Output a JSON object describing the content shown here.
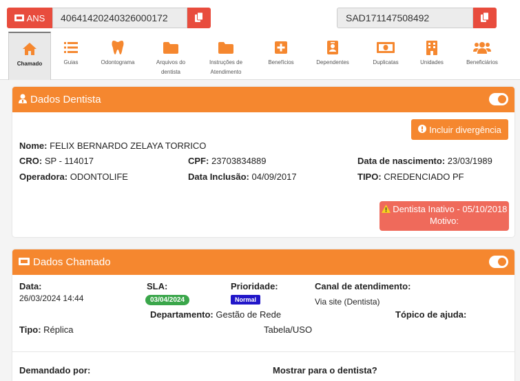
{
  "header": {
    "ans_label": "ANS",
    "ans_value": "40641420240326000172",
    "sad_value": "SAD171147508492"
  },
  "tabs": [
    {
      "label": "Chamado",
      "icon": "home-icon"
    },
    {
      "label": "Guias",
      "icon": "list-icon"
    },
    {
      "label": "Odontograma",
      "icon": "tooth-icon"
    },
    {
      "label": "Arquivos do dentista",
      "icon": "folder-icon"
    },
    {
      "label": "Instruções de Atendimento",
      "icon": "folder-icon"
    },
    {
      "label": "Benefícios",
      "icon": "plus-square-icon"
    },
    {
      "label": "Dependentes",
      "icon": "id-badge-icon"
    },
    {
      "label": "Duplicatas",
      "icon": "money-bill-icon"
    },
    {
      "label": "Unidades",
      "icon": "building-icon"
    },
    {
      "label": "Beneficiários",
      "icon": "users-icon"
    }
  ],
  "dentista": {
    "title": "Dados Dentista",
    "incluir_btn": "Incluir divergência",
    "nome_label": "Nome:",
    "nome": "FELIX BERNARDO ZELAYA TORRICO",
    "cro_label": "CRO:",
    "cro": "SP - 114017",
    "cpf_label": "CPF:",
    "cpf": "23703834889",
    "nasc_label": "Data de nascimento:",
    "nasc": "23/03/1989",
    "operadora_label": "Operadora:",
    "operadora": "ODONTOLIFE",
    "inclusao_label": "Data Inclusão:",
    "inclusao": "04/09/2017",
    "tipo_label": "TIPO:",
    "tipo": "CREDENCIADO PF",
    "alert_line1": "Dentista Inativo - 05/10/2018",
    "alert_line2": "Motivo:"
  },
  "chamado": {
    "title": "Dados Chamado",
    "data_label": "Data:",
    "data": "26/03/2024 14:44",
    "sla_label": "SLA:",
    "sla": "03/04/2024",
    "prioridade_label": "Prioridade:",
    "prioridade": "Normal",
    "canal_label": "Canal de atendimento:",
    "canal": "Via site (Dentista)",
    "departamento_label": "Departamento:",
    "departamento": "Gestão de Rede",
    "topico_label": "Tópico de ajuda:",
    "tipo_label": "Tipo:",
    "tipo": "Réplica",
    "tabela": "Tabela/USO",
    "demandado_label": "Demandado por:",
    "mostrar_label": "Mostrar para o dentista?"
  },
  "colors": {
    "accent": "#f5872f",
    "danger": "#e84c3d",
    "alert": "#ef6a5b",
    "sla_badge": "#3aa64a",
    "priority_badge": "#2116c9"
  }
}
